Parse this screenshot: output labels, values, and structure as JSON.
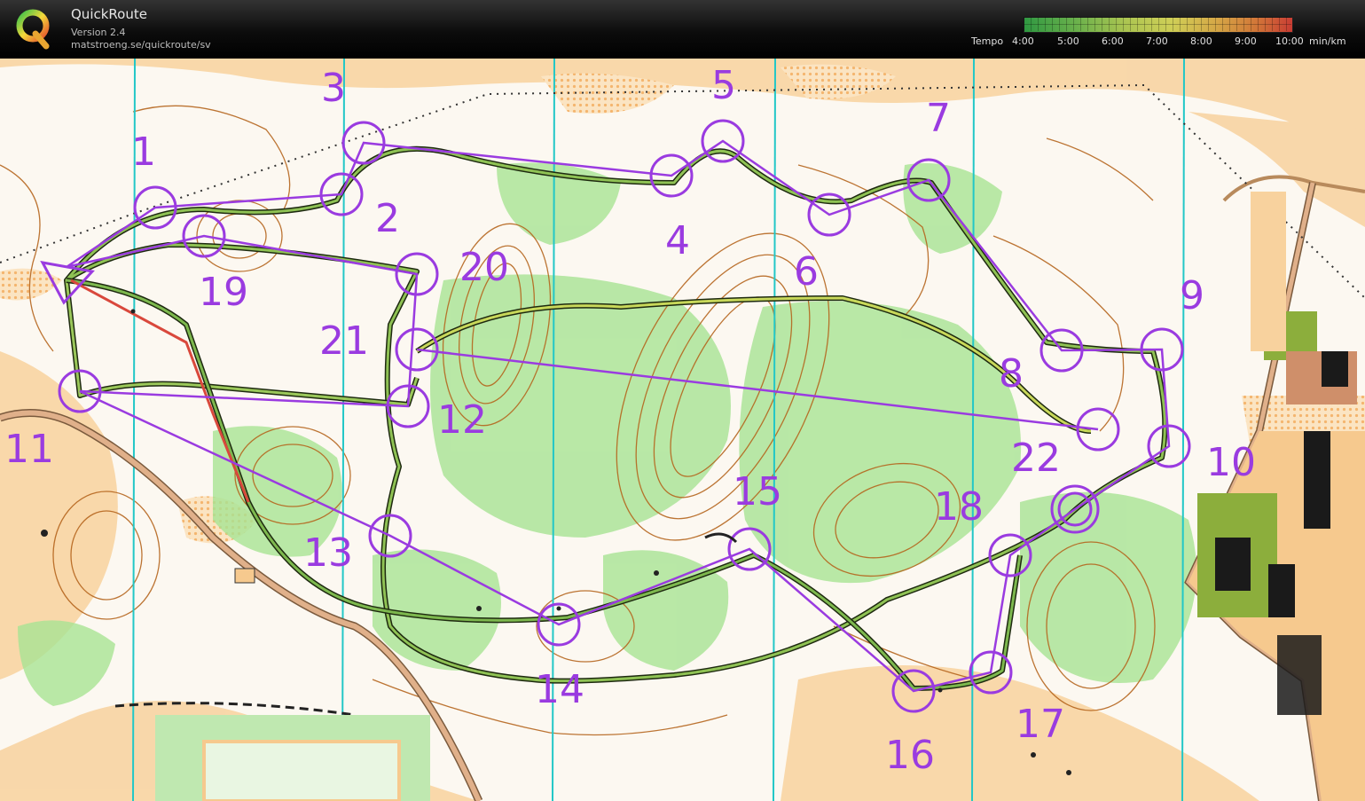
{
  "app": {
    "title": "QuickRoute",
    "version": "Version 2.4",
    "url": "matstroeng.se/quickroute/sv"
  },
  "legend": {
    "label": "Tempo",
    "ticks": [
      "4:00",
      "5:00",
      "6:00",
      "7:00",
      "8:00",
      "9:00",
      "10:00"
    ],
    "unit": "min/km"
  },
  "course": {
    "controls": [
      "1",
      "2",
      "3",
      "4",
      "5",
      "6",
      "7",
      "8",
      "9",
      "10",
      "11",
      "12",
      "13",
      "14",
      "15",
      "16",
      "17",
      "18",
      "19",
      "20",
      "21",
      "22"
    ],
    "colors": {
      "course": "#9a3be0",
      "contour": "#b5651d",
      "vegetation_green": "#9fe08a",
      "open_yellow": "#f6c98e",
      "magnetic_north_lines": "#22c7c7",
      "route": "#2c3a1a",
      "road": "#c8906a"
    }
  }
}
